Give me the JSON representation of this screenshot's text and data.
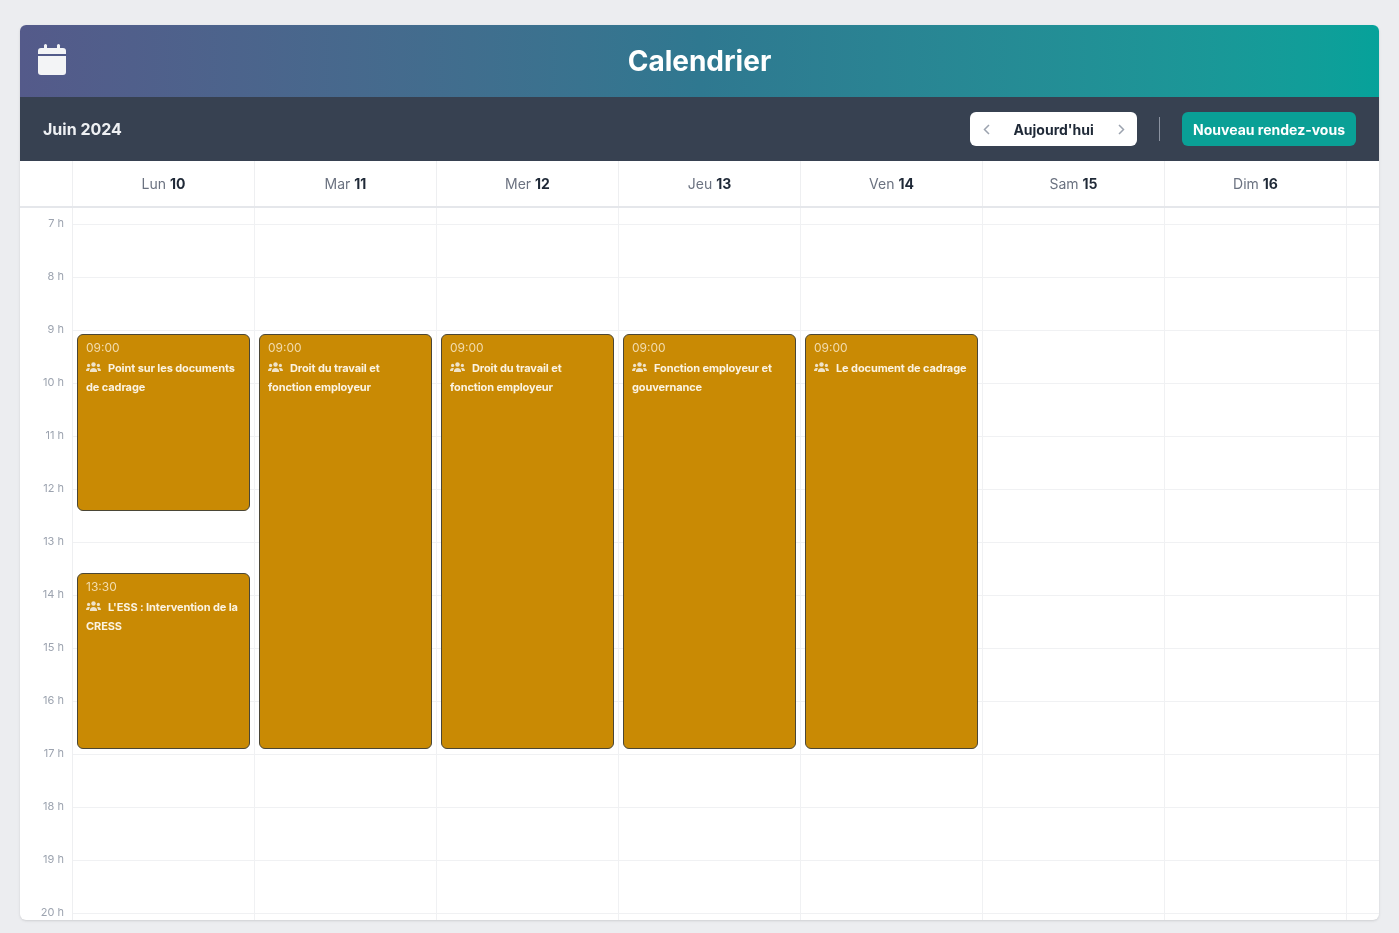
{
  "header": {
    "title": "Calendrier"
  },
  "toolbar": {
    "month": "Juin 2024",
    "today_button": "Aujourd'hui",
    "new_button": "Nouveau rendez-vous"
  },
  "hours": [
    "7 h",
    "8 h",
    "9 h",
    "10 h",
    "11 h",
    "12 h",
    "13 h",
    "14 h",
    "15 h",
    "16 h",
    "17 h",
    "18 h",
    "19 h",
    "20 h"
  ],
  "days": [
    {
      "weekday": "Lun",
      "date": "10",
      "events": [
        {
          "kind": "morning",
          "time": "09:00",
          "title": "Point sur les documents de cadrage"
        },
        {
          "kind": "afternoon",
          "time": "13:30",
          "title": "L'ESS : Intervention de la CRESS"
        }
      ]
    },
    {
      "weekday": "Mar",
      "date": "11",
      "events": [
        {
          "kind": "full_day",
          "time": "09:00",
          "title": "Droit du travail et fonction employeur"
        }
      ]
    },
    {
      "weekday": "Mer",
      "date": "12",
      "events": [
        {
          "kind": "full_day",
          "time": "09:00",
          "title": "Droit du travail et fonction employeur"
        }
      ]
    },
    {
      "weekday": "Jeu",
      "date": "13",
      "events": [
        {
          "kind": "full_day",
          "time": "09:00",
          "title": "Fonction employeur et gouvernance"
        }
      ]
    },
    {
      "weekday": "Ven",
      "date": "14",
      "events": [
        {
          "kind": "full_day",
          "time": "09:00",
          "title": "Le document de cadrage"
        }
      ]
    },
    {
      "weekday": "Sam",
      "date": "15"
    },
    {
      "weekday": "Dim",
      "date": "16"
    }
  ]
}
